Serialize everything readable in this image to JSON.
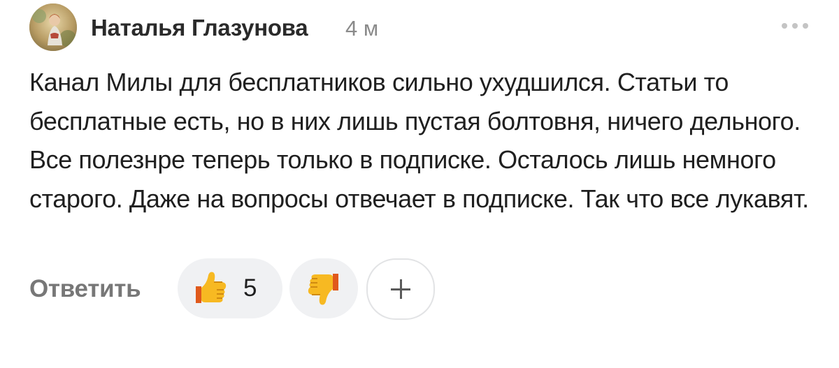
{
  "comment": {
    "author": "Наталья Глазунова",
    "time": "4 м",
    "more_icon": "ellipsis-icon",
    "text": "Канал Милы для бесплатников сильно ухудшился. Статьи то бесплатные есть, но в них лишь пустая болтовня, ничего дельного. Все полезнре теперь только в подписке. Осталось лишь немного старого. Даже на вопросы отвечает в подписке. Так что все лукавят."
  },
  "actions": {
    "reply_label": "Ответить",
    "like_icon": "thumbs-up-icon",
    "like_count": "5",
    "dislike_icon": "thumbs-down-icon",
    "add_reaction_icon": "plus-icon"
  },
  "colors": {
    "author": "#2a2a2a",
    "meta": "#8a8a8a",
    "reply": "#777777",
    "pill_bg": "#f0f1f3"
  }
}
